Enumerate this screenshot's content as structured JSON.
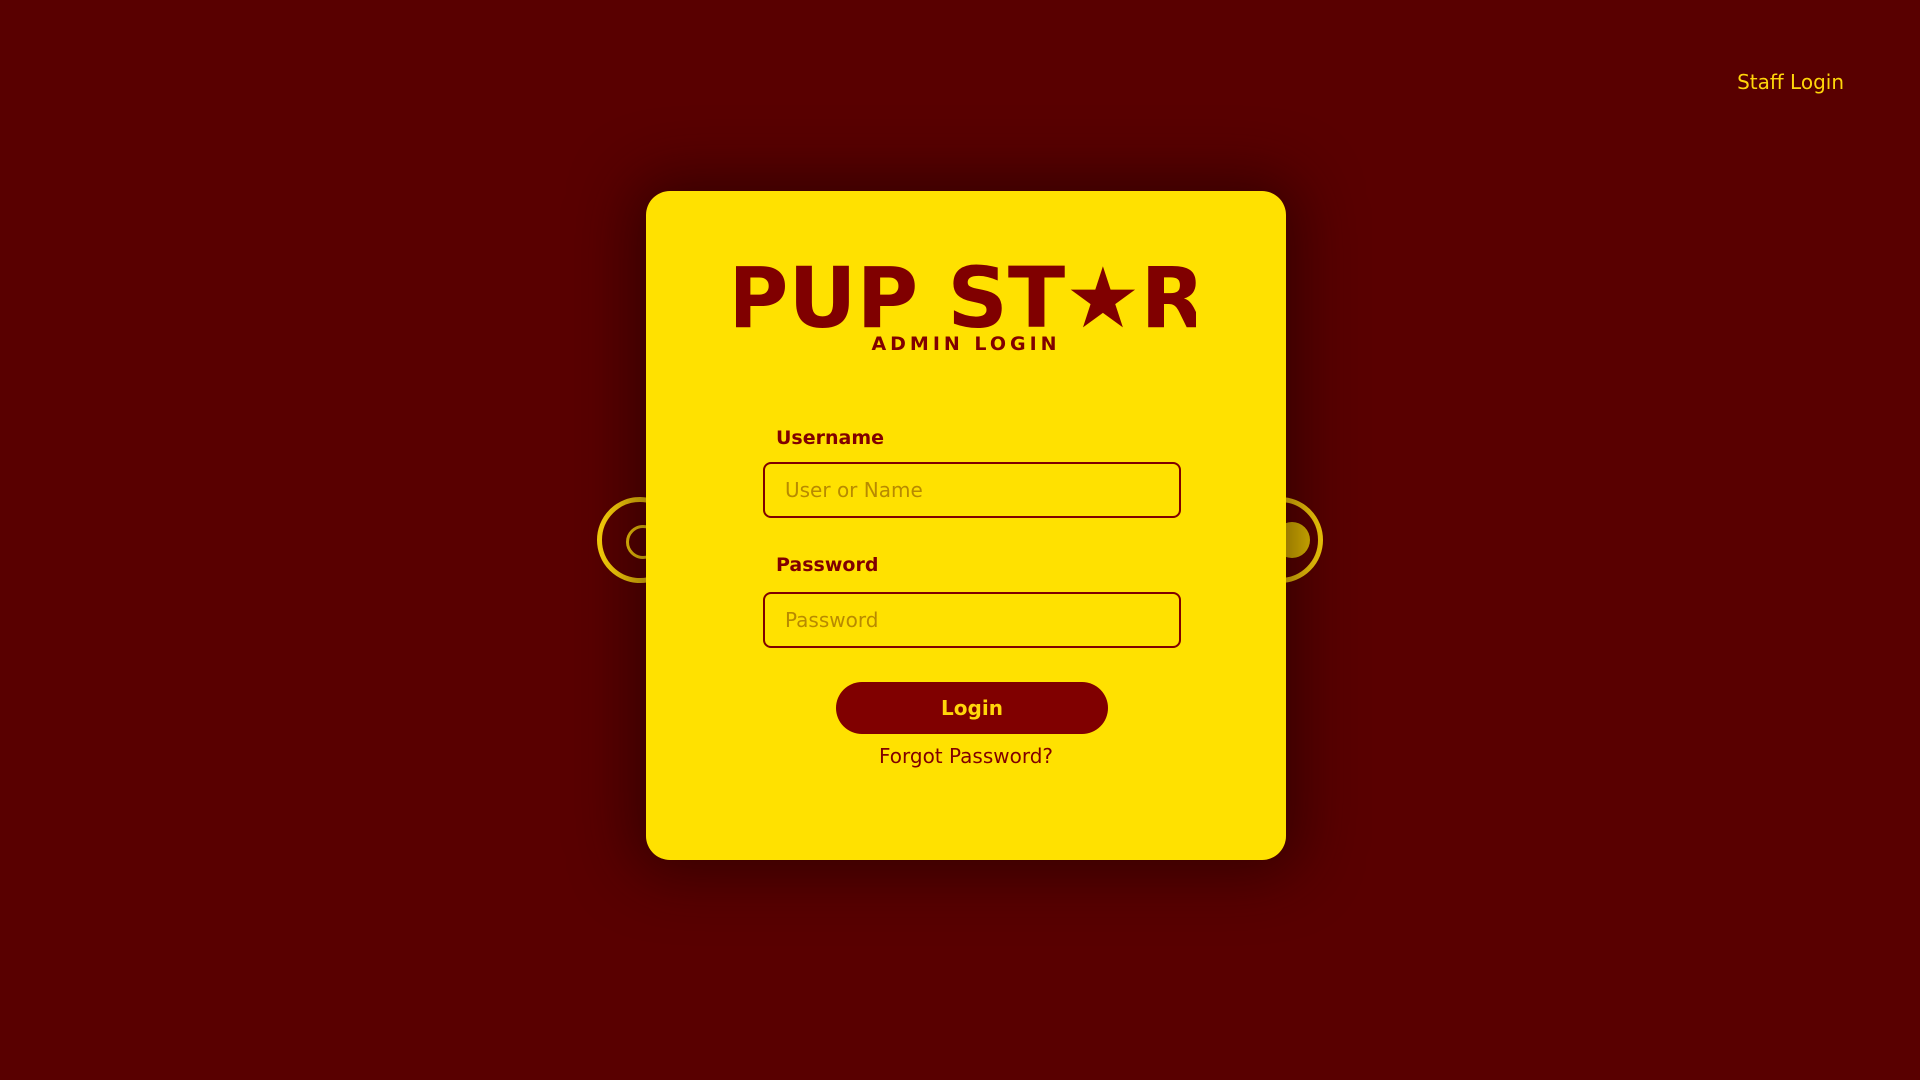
{
  "header": {
    "staff_login_label": "Staff Login"
  },
  "card": {
    "logo_text": "PUP ST★R",
    "subtitle": "ADMIN LOGIN"
  },
  "form": {
    "username_label": "Username",
    "username_placeholder": "User or Name",
    "username_value": "",
    "password_label": "Password",
    "password_placeholder": "Password",
    "password_value": "",
    "login_button_label": "Login",
    "forgot_password_label": "Forgot Password?"
  },
  "icons": {
    "logo_star": "star-icon",
    "left_decoration": "ring-icon",
    "right_decoration": "toggle-knob-icon"
  },
  "colors": {
    "background": "#590000",
    "card": "#ffe100",
    "primary_text": "#800000",
    "accent": "#ffd60a"
  }
}
